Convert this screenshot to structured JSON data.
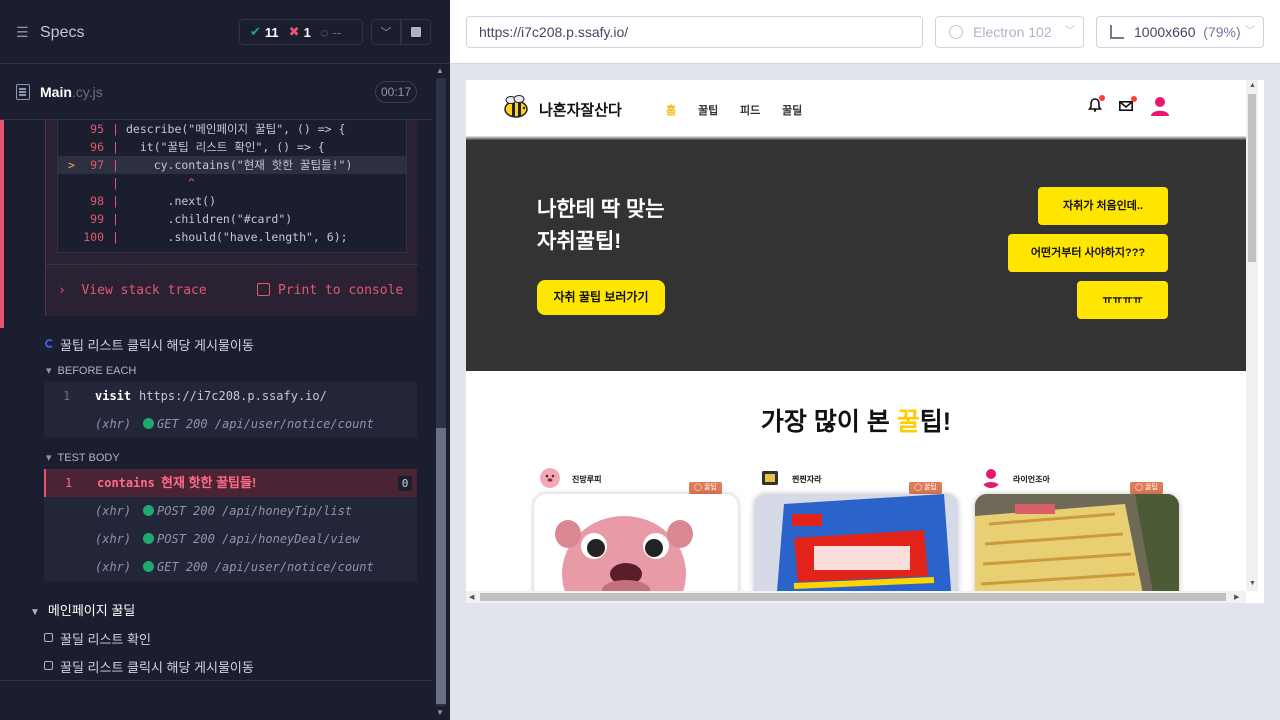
{
  "runner": {
    "specs_label": "Specs",
    "stats": {
      "passed": "11",
      "failed": "1",
      "pending": "--"
    },
    "file": {
      "name": "Main",
      "ext": ".cy.js",
      "duration": "00:17"
    }
  },
  "error": {
    "code_lines": [
      {
        "num": "95",
        "src": "describe(\"메인페이지 꿀팁\", () => {"
      },
      {
        "num": "96",
        "src": "  it(\"꿀팁 리스트 확인\", () => {"
      },
      {
        "num": "97",
        "src": "    cy.contains(\"현재 핫한 꿀팁들!\")"
      },
      {
        "num": "",
        "src": ""
      },
      {
        "num": "98",
        "src": "      .next()"
      },
      {
        "num": "99",
        "src": "      .children(\"#card\")"
      },
      {
        "num": "100",
        "src": "      .should(\"have.length\", 6);"
      }
    ],
    "caret": "^",
    "view_stack": "View stack trace",
    "print_console": "Print to console"
  },
  "tests": {
    "running_test": "꿀팁 리스트 클릭시 해당 게시물이동",
    "before_each_label": "BEFORE EACH",
    "before_each": [
      {
        "num": "1",
        "name": "visit",
        "msg": "https://i7c208.p.ssafy.io/"
      },
      {
        "num": "",
        "name": "(xhr)",
        "msg": "GET 200 /api/user/notice/count"
      }
    ],
    "test_body_label": "TEST BODY",
    "test_body": [
      {
        "num": "1",
        "name": "contains",
        "msg": "현재 핫한 꿀팁들!",
        "count": "0"
      },
      {
        "num": "",
        "name": "(xhr)",
        "msg": "POST 200 /api/honeyTip/list"
      },
      {
        "num": "",
        "name": "(xhr)",
        "msg": "POST 200 /api/honeyDeal/view"
      },
      {
        "num": "",
        "name": "(xhr)",
        "msg": "GET 200 /api/user/notice/count"
      }
    ],
    "suite": "메인페이지 꿀딜",
    "pending_tests": [
      "꿀딜 리스트 확인",
      "꿀딜 리스트 클릭시 해당 게시물이동"
    ]
  },
  "aut": {
    "url": "https://i7c208.p.ssafy.io/",
    "browser": "Electron 102",
    "viewport": "1000x660",
    "scale": "(79%)"
  },
  "app": {
    "logo": "나혼자잘산다",
    "nav": [
      "홈",
      "꿀팁",
      "피드",
      "꿀딜"
    ],
    "hero_line1": "나한테 딱 맞는",
    "hero_line2": "자취꿀팁!",
    "hero_button": "자취 꿀팁 보러가기",
    "bubbles": [
      "자취가 처음인데..",
      "어떤거부터 사야하지???",
      "ㅠㅠㅠㅠ"
    ],
    "popular_title_pre": "가장 많이 본 ",
    "popular_title_accent": "꿀",
    "popular_title_post": "팁!",
    "cards": [
      {
        "author": "진망루피",
        "tag": "꿀팁"
      },
      {
        "author": "찐찐자라",
        "tag": "꿀팁"
      },
      {
        "author": "라이언조아",
        "tag": "꿀팁"
      }
    ],
    "colors": {
      "accent": "#ffe600",
      "hero_bg": "#333333"
    }
  }
}
